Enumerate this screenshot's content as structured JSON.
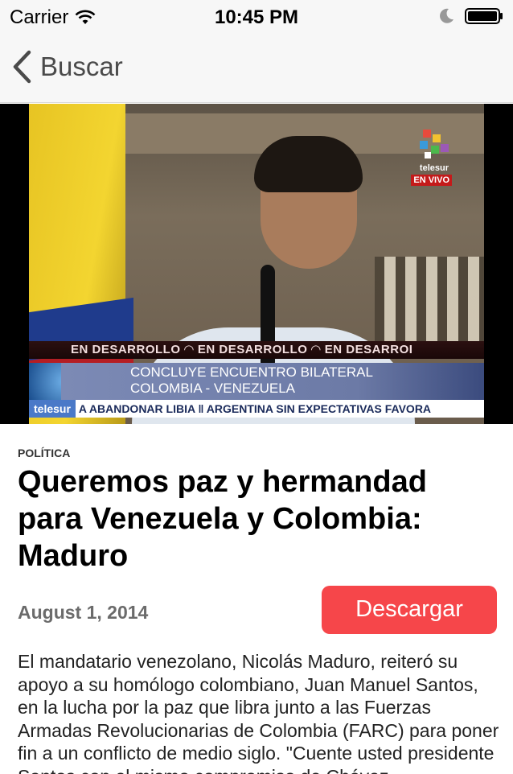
{
  "status_bar": {
    "carrier": "Carrier",
    "time": "10:45 PM",
    "icons": [
      "wifi-icon",
      "moon-icon",
      "battery-icon"
    ]
  },
  "nav": {
    "back_label": "Buscar",
    "back_icon": "chevron-left-icon"
  },
  "media": {
    "channel_brand": "telesur",
    "live_label": "EN VIVO",
    "developing_ticker": "EN DESARROLLO ◠ EN DESARROLLO ◠ EN DESARROI",
    "headline_line1": "CONCLUYE ENCUENTRO BILATERAL",
    "headline_line2": "COLOMBIA - VENEZUELA",
    "bottom_ticker_brand": "telesur",
    "bottom_ticker_text": "A ABANDONAR LIBIA ‖ ARGENTINA SIN EXPECTATIVAS FAVORA"
  },
  "article": {
    "category": "POLÍTICA",
    "title": "Queremos paz y hermandad para Venezuela y Colombia: Maduro",
    "date": "August 1, 2014",
    "download_label": "Descargar",
    "body": "El mandatario venezolano, Nicolás Maduro, reiteró su apoyo a su homólogo colombiano, Juan Manuel Santos, en la lucha por la paz que libra junto a las Fuerzas Armadas Revolucionarias de Colombia (FARC) para poner fin a un conflicto de medio siglo. \"Cuente usted presidente Santos con el mismo compromiso de Chávez"
  },
  "colors": {
    "accent_button": "#f6464a",
    "nav_background": "#f7f7f7"
  }
}
